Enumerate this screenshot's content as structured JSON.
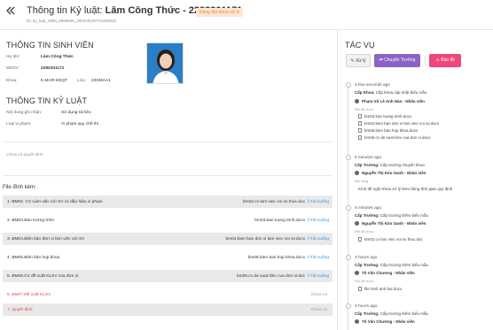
{
  "header": {
    "title_prefix": "Thông tin Kỷ luật: ",
    "title_name": "Lâm Công Thức - 2282301171",
    "status": "Đang đợi khoa xử lý",
    "record_id": "ID: ky_luat_1963_6666666_280220240741163633"
  },
  "student_section": {
    "title": "THÔNG TIN SINH VIÊN",
    "fields": [
      {
        "label": "Họ tên:",
        "value": "Lâm Công Thức"
      },
      {
        "label": "MSSV:",
        "value": "2282301171"
      },
      {
        "label": "Khoa:",
        "value": "K.MAR-KDQT"
      }
    ],
    "class_label": "Lớp:",
    "class_value": "22DMAA1"
  },
  "discipline_section": {
    "title": "THÔNG TIN KỶ LUẬT",
    "fields": [
      {
        "label": "Nội dung ghi nhận:",
        "value": "Sử dụng tài liệu"
      },
      {
        "label": "Loại vi phạm:",
        "value": "Vi phạm quy chế thi"
      }
    ],
    "decision": "Chưa có quyết định"
  },
  "files": {
    "title": "File đính kèm:",
    "download_label": "Tải xuống",
    "empty_label": "Chưa có",
    "rows": [
      {
        "name": "1. BM02. CV Làm việc với SV có dấu hiệu vi phạm",
        "doc": "bm02.cv lam viec voi sv thuc.doc"
      },
      {
        "name": "2. BM03.Bản tường trình",
        "doc": "bm03.ban tuong trinh.docx"
      },
      {
        "name": "3. BM04.Biên bản đơn vị làm việc với SV",
        "doc": "bm04.bien ban don vi lam viec voi sv.docx"
      },
      {
        "name": "4. BM05.Biên bản họp khoa",
        "doc": "bm05.bien ban hop khoa.docx"
      },
      {
        "name": "5. BM06.CV đề xuất KLSV của đơn vị",
        "doc": "bm06.cv de xuat klsv cua don vi.doc"
      },
      {
        "name": "6. BM07.Đề xuất KLSV",
        "doc": ""
      },
      {
        "name": "7. Quyết định",
        "doc": ""
      }
    ]
  },
  "actions": {
    "title": "TÁC VỤ",
    "process_label": "Xử lý",
    "transfer_label": "Chuyển Trường",
    "report_label": "Báo lỗi"
  },
  "timeline": [
    {
      "time": "a few seconds ago",
      "role": "Cấp Khoa:",
      "action": "Cấp khoa cập nhật biểu mẫu",
      "user": "Phạm Vũ Lê Anh Hào - Nhân viên",
      "sub": "File đã chọn:",
      "files": [
        "bm03.ban tuong trinh.docx",
        "bm04.bien ban don vi lam viec voi sv.docx",
        "bm05.bien ban hop khoa.docx",
        "bm06.cv de xuat klsv cua don vi.docx"
      ],
      "note": ""
    },
    {
      "time": "5 minutes ago",
      "role": "Cấp Trường:",
      "action": "Cấp trường chuyển khoa",
      "user": "Nguyễn Thị Kim Oanh - Nhân viên",
      "sub": "Nội dung:",
      "files": [],
      "note": "Kính đề nghị Khoa xử lý theo đúng thời gian quy định"
    },
    {
      "time": "6 minutes ago",
      "role": "Cấp Trường:",
      "action": "Cấp trường thêm biểu mẫu",
      "user": "Nguyễn Thị Kim Oanh - Nhân viên",
      "sub": "File đã chọn:",
      "files": [
        "bm02.cv lam viec voi sv thuc.doc"
      ],
      "note": ""
    },
    {
      "time": "3 hours ago",
      "role": "Cấp Trường:",
      "action": "Cấp trường thêm biểu mẫu",
      "user": "Tô Văn Chương - Nhân viên",
      "sub": "File đã chọn:",
      "files": [
        "file hinh anh bai.docx"
      ],
      "note": ""
    },
    {
      "time": "3 hours ago",
      "role": "Cấp Trường:",
      "action": "Cấp trường thêm biểu mẫu",
      "user": "Tô Văn Chương - Nhân viên",
      "sub": "",
      "files": [],
      "note": ""
    }
  ],
  "colors": {
    "accent_purple": "#8c63c4",
    "danger_pink": "#f0467a",
    "status_orange": "#e58b3e",
    "link_blue": "#2f8fe0",
    "missing_red": "#e04848"
  }
}
